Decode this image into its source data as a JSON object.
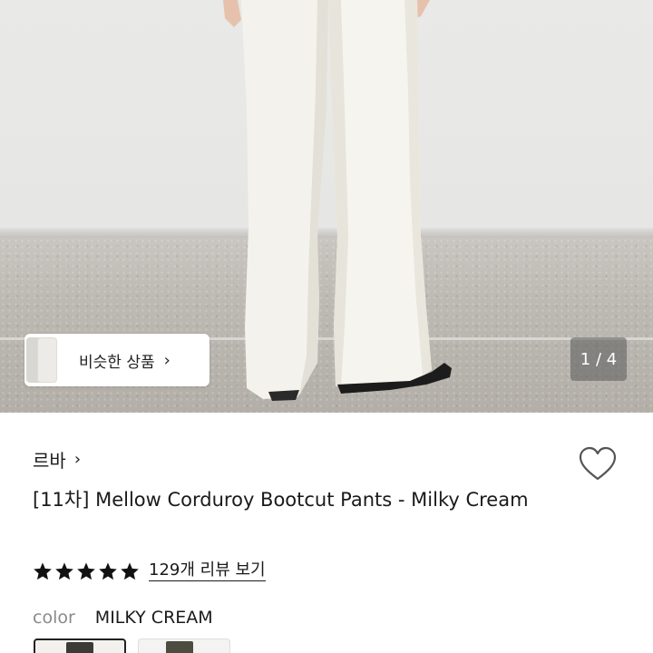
{
  "gallery": {
    "similar_label": "비슷한 상품",
    "similar_chevron": "›",
    "page_indicator": "1 / 4"
  },
  "product": {
    "brand": "르바",
    "brand_chevron": "›",
    "title": "[11차] Mellow Corduroy Bootcut Pants - Milky Cream",
    "rating_stars": 5,
    "review_link": "129개 리뷰 보기",
    "color_label": "color",
    "color_value": "MILKY CREAM"
  },
  "icons": {
    "heart": "heart-outline-icon",
    "star": "star-filled-icon",
    "chevron": "chevron-right-icon"
  },
  "colors": {
    "text": "#1a1a1a",
    "muted": "#8a8a8a",
    "star": "#111111",
    "pants": "#f3f1ea"
  }
}
